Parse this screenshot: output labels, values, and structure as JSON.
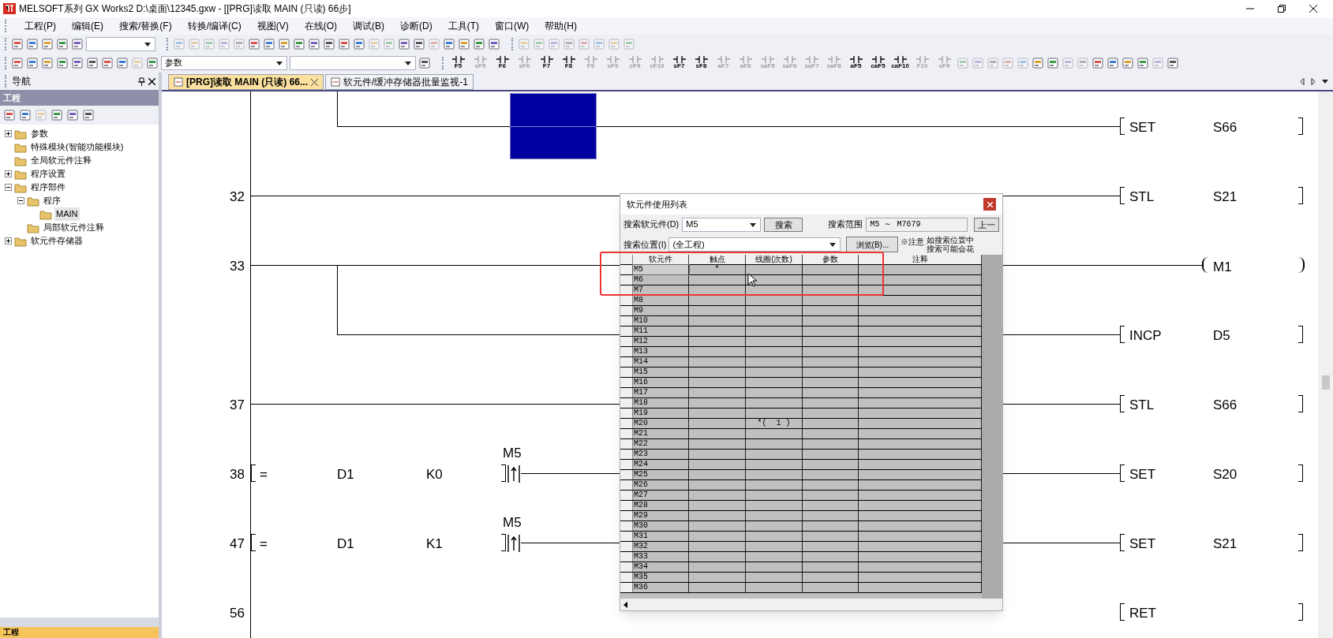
{
  "window": {
    "title": "MELSOFT系列 GX Works2 D:\\桌面\\12345.gxw - [[PRG]读取 MAIN (只读) 66步]"
  },
  "menu": [
    "工程(P)",
    "编辑(E)",
    "搜索/替换(F)",
    "转换/编译(C)",
    "视图(V)",
    "在线(O)",
    "调试(B)",
    "诊断(D)",
    "工具(T)",
    "窗口(W)",
    "帮助(H)"
  ],
  "toolbar": {
    "combo_value": "参数"
  },
  "ladder_keys": [
    {
      "label": "F5",
      "disabled": false
    },
    {
      "label": "sF5",
      "disabled": true
    },
    {
      "label": "F6",
      "disabled": false
    },
    {
      "label": "sF6",
      "disabled": true
    },
    {
      "label": "F7",
      "disabled": false
    },
    {
      "label": "F8",
      "disabled": false
    },
    {
      "label": "F9",
      "disabled": true
    },
    {
      "label": "sF9",
      "disabled": true
    },
    {
      "label": "cF9",
      "disabled": true
    },
    {
      "label": "cF10",
      "disabled": true
    },
    {
      "label": "sF7",
      "disabled": false
    },
    {
      "label": "sF8",
      "disabled": false
    },
    {
      "label": "aF7",
      "disabled": true
    },
    {
      "label": "aF8",
      "disabled": true
    },
    {
      "label": "saF5",
      "disabled": true
    },
    {
      "label": "saF6",
      "disabled": true
    },
    {
      "label": "saF7",
      "disabled": true
    },
    {
      "label": "saF8",
      "disabled": true
    },
    {
      "label": "aF5",
      "disabled": false
    },
    {
      "label": "caF5",
      "disabled": false
    },
    {
      "label": "caF10",
      "disabled": false
    },
    {
      "label": "F10",
      "disabled": true
    },
    {
      "label": "sF9",
      "disabled": true
    }
  ],
  "navigation": {
    "title": "导航",
    "section": "工程",
    "tree": [
      {
        "label": "参数",
        "expanded": false,
        "selected": false
      },
      {
        "label": "特殊模块(智能功能模块)",
        "selected": false
      },
      {
        "label": "全局软元件注释",
        "selected": false
      },
      {
        "label": "程序设置",
        "expanded": false,
        "selected": false
      },
      {
        "label": "程序部件",
        "expanded": true,
        "selected": false,
        "children": [
          {
            "label": "程序",
            "expanded": true,
            "selected": false,
            "children": [
              {
                "label": "MAIN",
                "selected": true
              }
            ]
          },
          {
            "label": "局部软元件注释",
            "selected": false
          }
        ]
      },
      {
        "label": "软元件存储器",
        "expanded": false,
        "selected": false
      }
    ],
    "bottom_tab": "工程"
  },
  "tabs": [
    {
      "label": "[PRG]读取 MAIN (只读) 66...",
      "selected": true
    },
    {
      "label": "软元件/缓冲存储器批量监视-1",
      "selected": false
    }
  ],
  "ladder": {
    "rungs": [
      {
        "lines": [
          {
            "branch": true,
            "parts": [
              {
                "kind": "cursor"
              }
            ],
            "output": {
              "kind": "instruction",
              "op": "SET",
              "arg": "S66"
            }
          }
        ]
      },
      {
        "step": "32",
        "lines": [
          {
            "branch": false,
            "output": {
              "kind": "instruction",
              "op": "STL",
              "arg": "S21"
            }
          }
        ]
      },
      {
        "step": "33",
        "lines": [
          {
            "branch": false,
            "output": {
              "kind": "coil",
              "arg": "M1"
            }
          },
          {
            "branch": true,
            "output": {
              "kind": "instruction",
              "op": "INCP",
              "arg": "D5"
            }
          }
        ]
      },
      {
        "step": "37",
        "lines": [
          {
            "branch": false,
            "output": {
              "kind": "instruction",
              "op": "STL",
              "arg": "S66"
            }
          }
        ]
      },
      {
        "step": "38",
        "lines": [
          {
            "branch": false,
            "parts": [
              {
                "kind": "compare",
                "op": "=",
                "a": "D1",
                "b": "K0"
              },
              {
                "kind": "contact",
                "device": "M5"
              }
            ],
            "output": {
              "kind": "instruction",
              "op": "SET",
              "arg": "S20"
            }
          }
        ]
      },
      {
        "step": "47",
        "lines": [
          {
            "branch": false,
            "parts": [
              {
                "kind": "compare",
                "op": "=",
                "a": "D1",
                "b": "K1"
              },
              {
                "kind": "contact",
                "device": "M5"
              }
            ],
            "output": {
              "kind": "instruction",
              "op": "SET",
              "arg": "S21"
            }
          }
        ]
      },
      {
        "step": "56",
        "lines": [
          {
            "branch": false,
            "output": {
              "kind": "instruction",
              "op": "RET"
            }
          }
        ]
      }
    ]
  },
  "dialog": {
    "title": "软元件使用列表",
    "device_label": "搜索软元件(D)",
    "device_value": "M5",
    "search_button": "搜索",
    "range_label": "搜索范围",
    "range_value": "M5 ～ M7679",
    "prev_button": "上一",
    "location_label": "搜索位置(I)",
    "location_value": "(全工程)",
    "browse_button": "浏览(B)...",
    "note_mark": "※注意",
    "note_lines": [
      "如搜索位置中",
      "搜索可能会花"
    ],
    "columns": [
      "软元件",
      "触点",
      "线圈(次数)",
      "参数",
      "注释"
    ],
    "rows": [
      {
        "device": "M5",
        "contact": "*",
        "selected": true
      },
      {
        "device": "M6",
        "selected": false
      },
      {
        "device": "M7",
        "selected": false
      },
      {
        "device": "M8",
        "selected": false
      },
      {
        "device": "M9",
        "selected": false
      },
      {
        "device": "M10",
        "selected": false
      },
      {
        "device": "M11",
        "selected": false
      },
      {
        "device": "M12",
        "selected": false
      },
      {
        "device": "M13",
        "selected": false
      },
      {
        "device": "M14",
        "selected": false
      },
      {
        "device": "M15",
        "selected": false
      },
      {
        "device": "M16",
        "selected": false
      },
      {
        "device": "M17",
        "selected": false
      },
      {
        "device": "M18",
        "selected": false
      },
      {
        "device": "M19",
        "selected": false
      },
      {
        "device": "M20",
        "coil": "*(  1 )",
        "selected": false
      },
      {
        "device": "M21",
        "selected": false
      },
      {
        "device": "M22",
        "selected": false
      },
      {
        "device": "M23",
        "selected": false
      },
      {
        "device": "M24",
        "selected": false
      },
      {
        "device": "M25",
        "selected": false
      },
      {
        "device": "M26",
        "selected": false
      },
      {
        "device": "M27",
        "selected": false
      },
      {
        "device": "M28",
        "selected": false
      },
      {
        "device": "M29",
        "selected": false
      },
      {
        "device": "M30",
        "selected": false
      },
      {
        "device": "M31",
        "selected": false
      },
      {
        "device": "M32",
        "selected": false
      },
      {
        "device": "M33",
        "selected": false
      },
      {
        "device": "M34",
        "selected": false
      },
      {
        "device": "M35",
        "selected": false
      },
      {
        "device": "M36",
        "selected": false
      }
    ]
  },
  "annotation": {
    "kind": "highlight"
  }
}
